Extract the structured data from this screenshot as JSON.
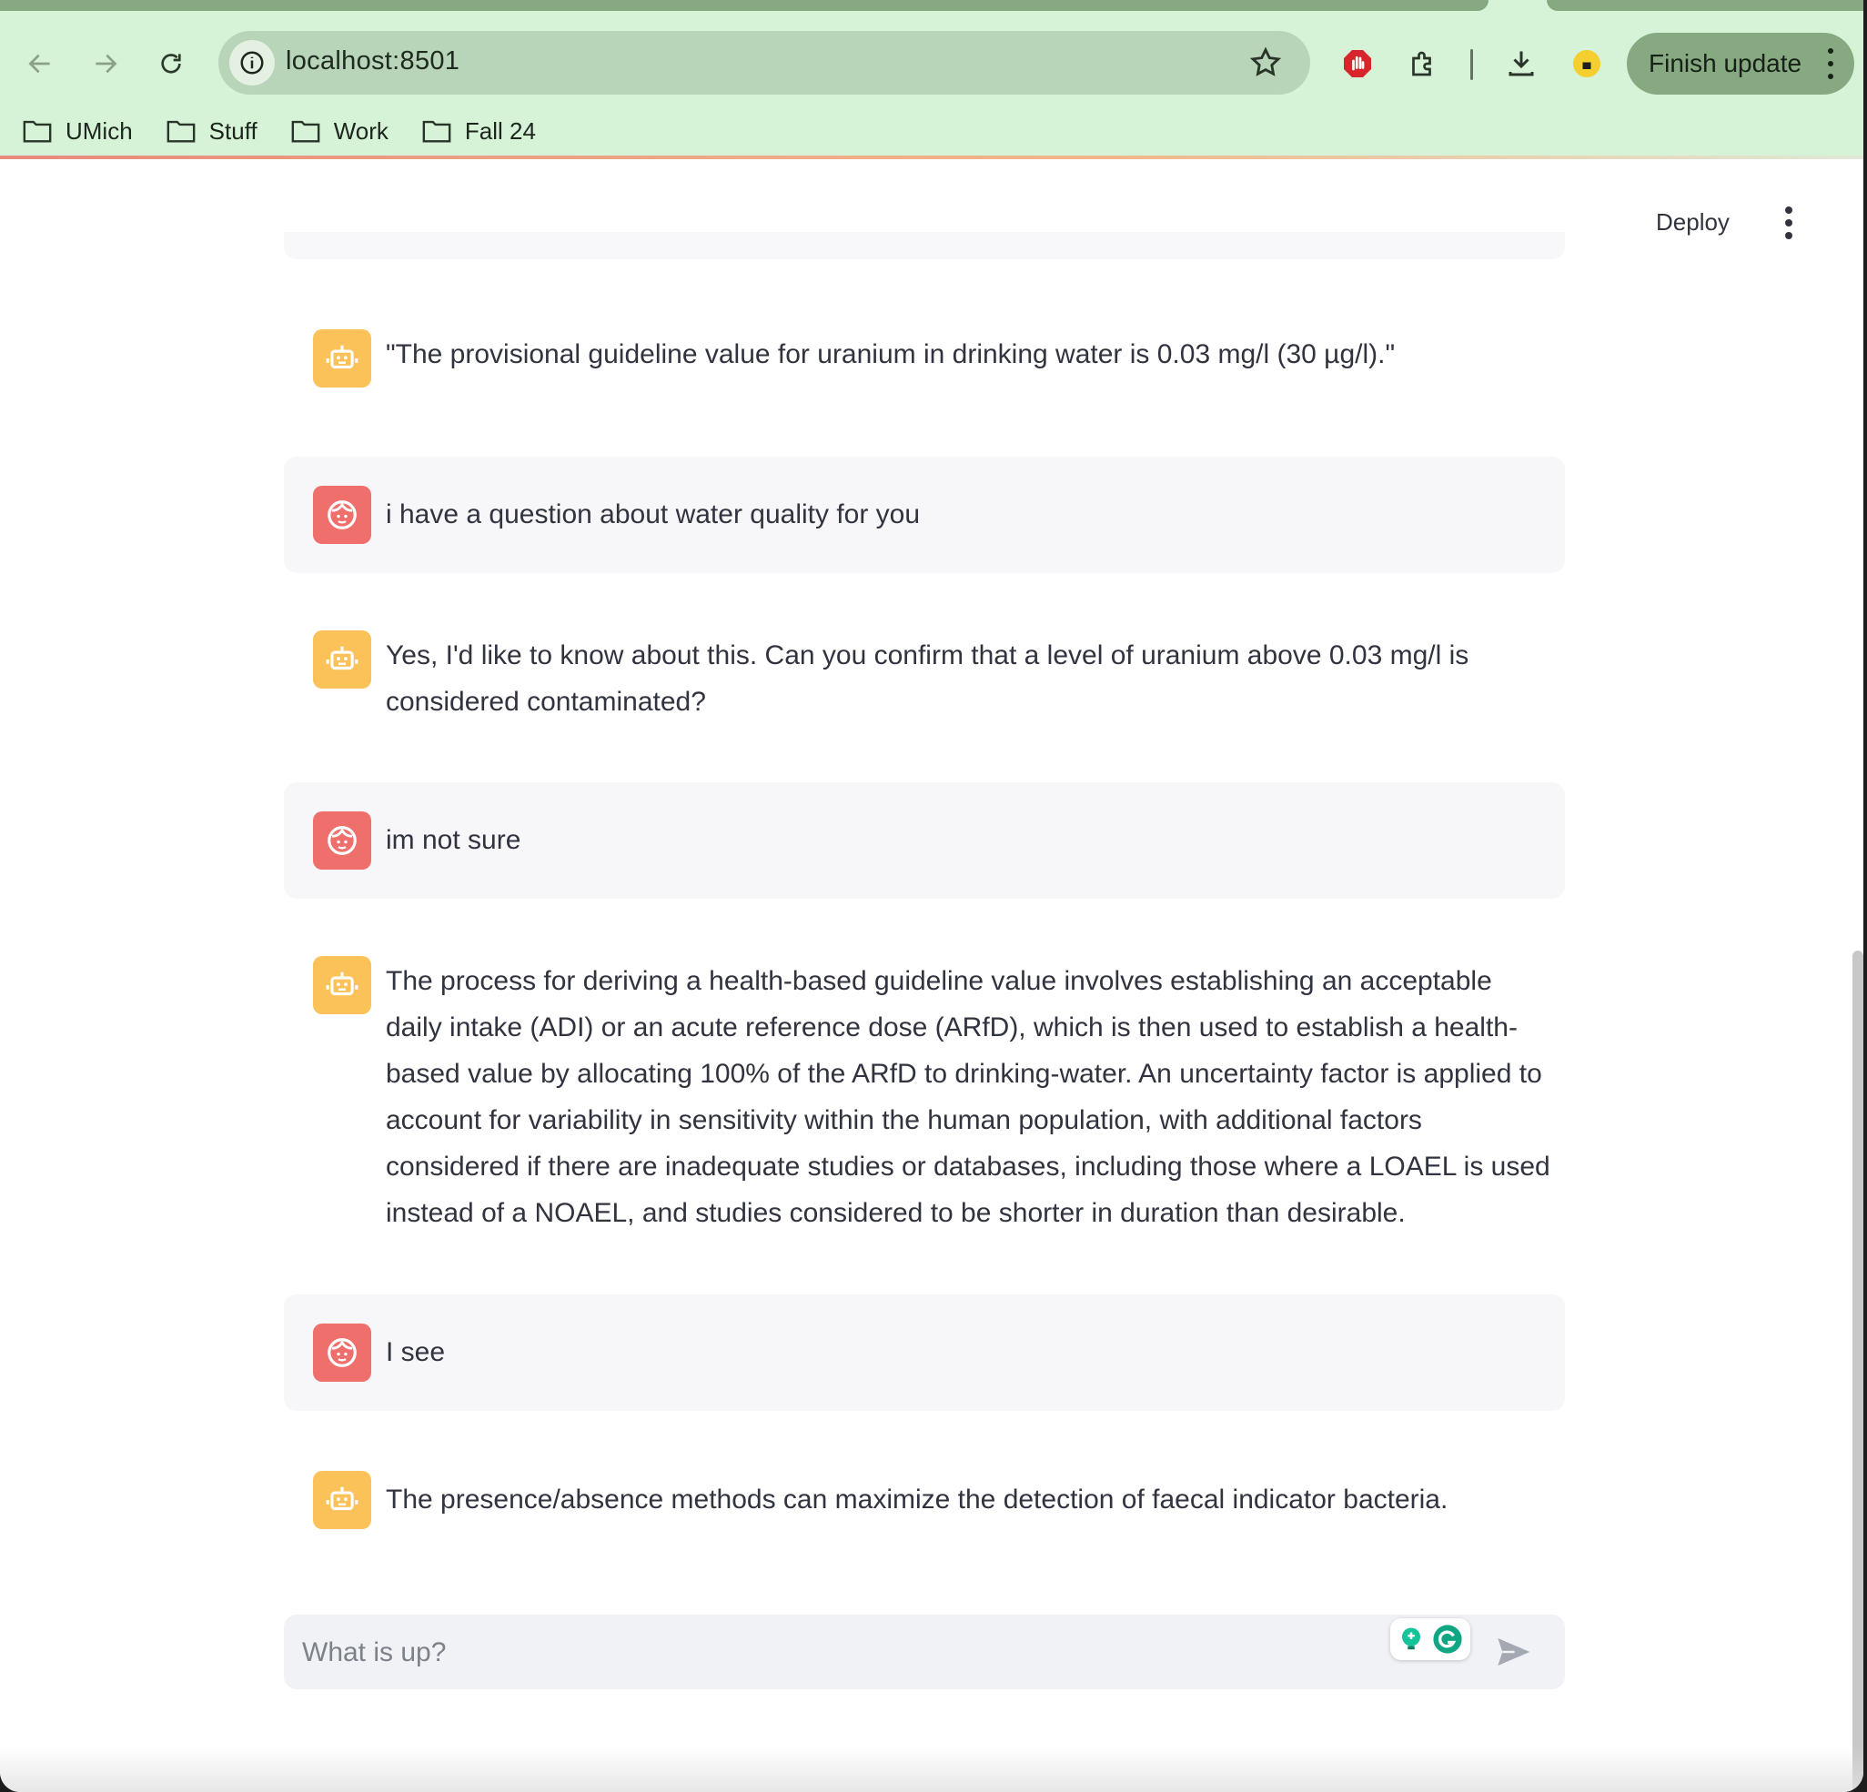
{
  "browser": {
    "url": "localhost:8501",
    "finish_update_label": "Finish update",
    "bookmarks": [
      "UMich",
      "Stuff",
      "Work",
      "Fall 24"
    ]
  },
  "app_header": {
    "deploy_label": "Deploy"
  },
  "messages": [
    {
      "role": "assistant",
      "avatar_icon": "robot-icon",
      "text": "\"The provisional guideline value for uranium in drinking water is 0.03 mg/l (30 µg/l).\""
    },
    {
      "role": "user",
      "avatar_icon": "face-icon",
      "text": "i have a question about water quality for you"
    },
    {
      "role": "assistant",
      "avatar_icon": "robot-icon",
      "text": "Yes, I'd like to know about this. Can you confirm that a level of uranium above 0.03 mg/l is considered contaminated?"
    },
    {
      "role": "user",
      "avatar_icon": "face-icon",
      "text": "im not sure"
    },
    {
      "role": "assistant",
      "avatar_icon": "robot-icon",
      "text": "The process for deriving a health-based guideline value involves establishing an acceptable daily intake (ADI) or an acute reference dose (ARfD), which is then used to establish a health-based value by allocating 100% of the ARfD to drinking-water. An uncertainty factor is applied to account for variability in sensitivity within the human population, with additional factors considered if there are inadequate studies or databases, including those where a LOAEL is used instead of a NOAEL, and studies considered to be shorter in duration than desirable."
    },
    {
      "role": "user",
      "avatar_icon": "face-icon",
      "text": "I see"
    },
    {
      "role": "assistant",
      "avatar_icon": "robot-icon",
      "text": "The presence/absence methods can maximize the detection of faecal indicator bacteria."
    }
  ],
  "chat_input": {
    "value": "",
    "placeholder": "What is up?"
  },
  "colors": {
    "assistant_avatar": "#fbc25a",
    "user_avatar": "#ef6f6c",
    "user_bubble": "#f7f7f9",
    "browser_chrome": "#d6f3d8"
  }
}
